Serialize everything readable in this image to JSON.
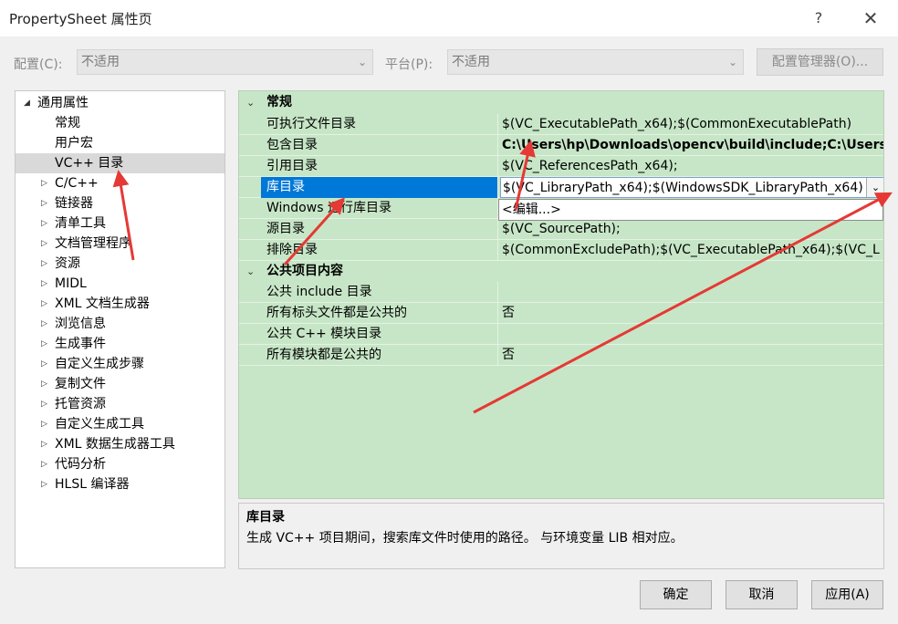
{
  "window": {
    "title": "PropertySheet 属性页",
    "help": "?",
    "close": "✕"
  },
  "config": {
    "config_label": "配置(C):",
    "config_value": "不适用",
    "platform_label": "平台(P):",
    "platform_value": "不适用",
    "manager_button": "配置管理器(O)..."
  },
  "tree": {
    "root": "通用属性",
    "items": [
      "常规",
      "用户宏",
      "VC++ 目录",
      "C/C++",
      "链接器",
      "清单工具",
      "文档管理程序",
      "资源",
      "MIDL",
      "XML 文档生成器",
      "浏览信息",
      "生成事件",
      "自定义生成步骤",
      "复制文件",
      "托管资源",
      "自定义生成工具",
      "XML 数据生成器工具",
      "代码分析",
      "HLSL 编译器"
    ]
  },
  "grid": {
    "cat1": "常规",
    "cat2": "公共项目内容",
    "rows": [
      {
        "name": "可执行文件目录",
        "value": "$(VC_ExecutablePath_x64);$(CommonExecutablePath)"
      },
      {
        "name": "包含目录",
        "value": "C:\\Users\\hp\\Downloads\\opencv\\build\\include;C:\\Users\\"
      },
      {
        "name": "引用目录",
        "value": "$(VC_ReferencesPath_x64);"
      },
      {
        "name": "库目录",
        "value": "$(VC_LibraryPath_x64);$(WindowsSDK_LibraryPath_x64)"
      },
      {
        "name": "Windows 运行库目录",
        "value": ""
      },
      {
        "name": "源目录",
        "value": "$(VC_SourcePath);"
      },
      {
        "name": "排除目录",
        "value": "$(CommonExcludePath);$(VC_ExecutablePath_x64);$(VC_L"
      }
    ],
    "rows2": [
      {
        "name": "公共 include 目录",
        "value": ""
      },
      {
        "name": "所有标头文件都是公共的",
        "value": "否"
      },
      {
        "name": "公共 C++ 模块目录",
        "value": ""
      },
      {
        "name": "所有模块都是公共的",
        "value": "否"
      }
    ],
    "dropdown_item": "<编辑...>"
  },
  "description": {
    "title": "库目录",
    "text": "生成 VC++ 项目期间，搜索库文件时使用的路径。 与环境变量 LIB 相对应。"
  },
  "buttons": {
    "ok": "确定",
    "cancel": "取消",
    "apply": "应用(A)"
  },
  "colors": {
    "grid_bg": "#c7e6c7",
    "selection": "#0078d7",
    "annotation_arrow": "#e53935"
  }
}
